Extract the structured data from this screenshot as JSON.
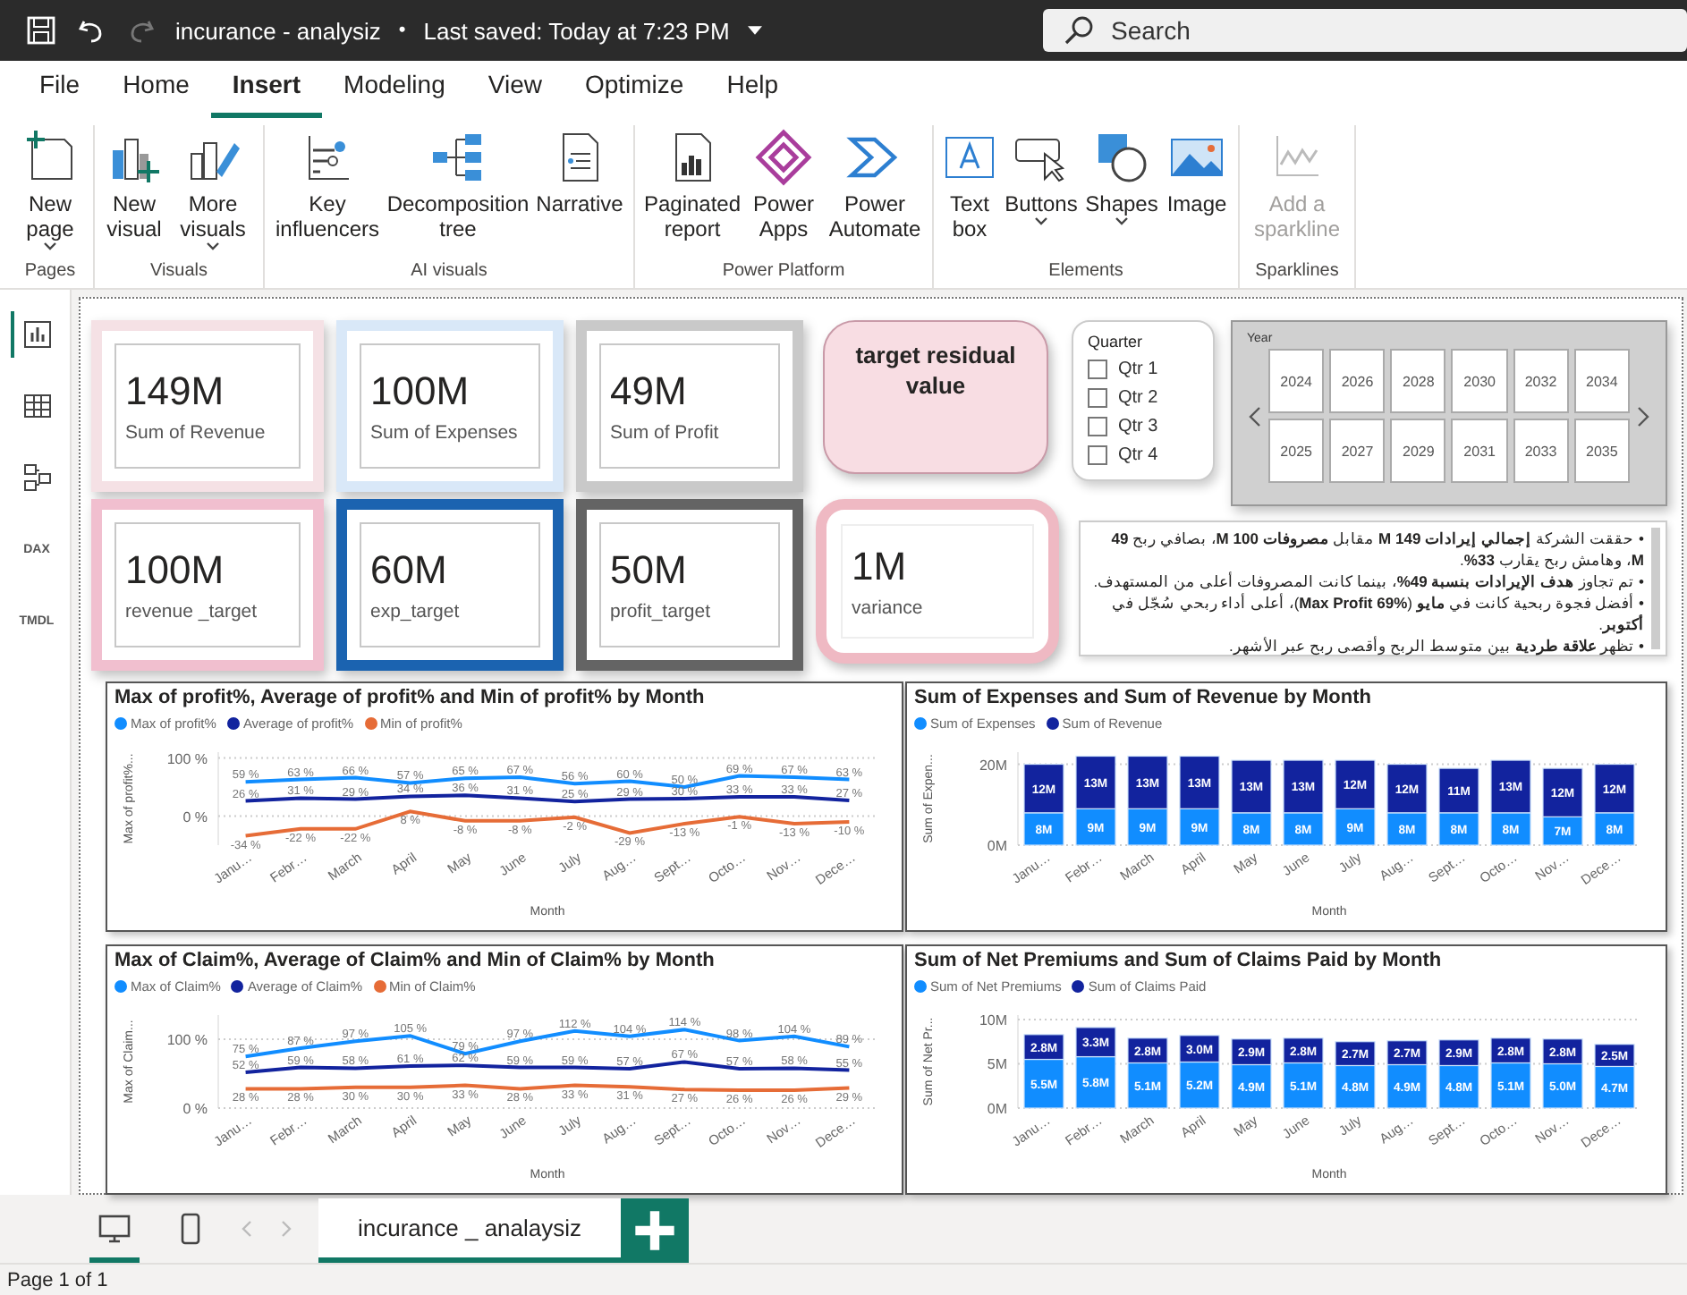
{
  "title_bar": {
    "file_name": "incurance - analysiz",
    "separator": "•",
    "save_status": "Last saved: Today at 7:23 PM",
    "redo_disabled": true,
    "search": {
      "placeholder": "Search"
    }
  },
  "menu_tabs": [
    {
      "label": "File",
      "selected": false
    },
    {
      "label": "Home",
      "selected": false
    },
    {
      "label": "Insert",
      "selected": true
    },
    {
      "label": "Modeling",
      "selected": false
    },
    {
      "label": "View",
      "selected": false
    },
    {
      "label": "Optimize",
      "selected": false
    },
    {
      "label": "Help",
      "selected": false
    }
  ],
  "ribbon_groups": [
    {
      "name": "Pages",
      "buttons": [
        {
          "kind": "new-page",
          "label": "New page",
          "dropdown": true,
          "disabled": false
        }
      ]
    },
    {
      "name": "Visuals",
      "buttons": [
        {
          "kind": "new-visual",
          "label": "New visual",
          "dropdown": false,
          "disabled": false
        },
        {
          "kind": "more-visuals",
          "label": "More visuals",
          "dropdown": true,
          "disabled": false
        }
      ]
    },
    {
      "name": "AI visuals",
      "buttons": [
        {
          "kind": "key-influencers",
          "label": "Key influencers",
          "dropdown": false,
          "disabled": false
        },
        {
          "kind": "decomposition",
          "label": "Decomposition tree",
          "dropdown": false,
          "disabled": false
        },
        {
          "kind": "narrative",
          "label": "Narrative",
          "dropdown": false,
          "disabled": false
        }
      ]
    },
    {
      "name": "Power Platform",
      "buttons": [
        {
          "kind": "paginated",
          "label": "Paginated report",
          "dropdown": false,
          "disabled": false
        },
        {
          "kind": "apps",
          "label": "Power Apps",
          "dropdown": false,
          "disabled": false
        },
        {
          "kind": "automate",
          "label": "Power Automate",
          "dropdown": false,
          "disabled": false
        }
      ]
    },
    {
      "name": "Elements",
      "buttons": [
        {
          "kind": "text-box",
          "label": "Text box",
          "dropdown": false,
          "disabled": false
        },
        {
          "kind": "buttons",
          "label": "Buttons",
          "dropdown": true,
          "disabled": false
        },
        {
          "kind": "shapes",
          "label": "Shapes",
          "dropdown": true,
          "disabled": false
        },
        {
          "kind": "image",
          "label": "Image",
          "dropdown": false,
          "disabled": false
        }
      ]
    },
    {
      "name": "Sparklines",
      "buttons": [
        {
          "kind": "sparkline",
          "label": "Add a sparkline",
          "dropdown": false,
          "disabled": true
        }
      ]
    }
  ],
  "side_rail": [
    {
      "kind": "report",
      "selected": true
    },
    {
      "kind": "table",
      "selected": false
    },
    {
      "kind": "model",
      "selected": false
    },
    {
      "kind": "dax",
      "label": "DAX",
      "selected": false
    },
    {
      "kind": "tmdl",
      "label": "TMDL",
      "selected": false
    }
  ],
  "kpi_cards": [
    {
      "value": "149M",
      "label": "Sum of Revenue",
      "color": "#f5e1e5"
    },
    {
      "value": "100M",
      "label": "Sum of Expenses",
      "color": "#d9e8f8"
    },
    {
      "value": "49M",
      "label": "Sum of Profit",
      "color": "#c9c9c9"
    },
    {
      "value": "100M",
      "label": "revenue _target",
      "color": "#f1bfcf"
    },
    {
      "value": "60M",
      "label": "exp_target",
      "color": "#1b63b0"
    },
    {
      "value": "50M",
      "label": "profit_target",
      "color": "#646464"
    }
  ],
  "target_card": {
    "title": "target residual value"
  },
  "variance_card": {
    "value": "1M",
    "label": "variance"
  },
  "quarter_slicer": {
    "title": "Quarter",
    "options": [
      {
        "label": "Qtr 1",
        "checked": false
      },
      {
        "label": "Qtr 2",
        "checked": false
      },
      {
        "label": "Qtr 3",
        "checked": false
      },
      {
        "label": "Qtr 4",
        "checked": false
      }
    ]
  },
  "year_slicer": {
    "title": "Year",
    "tiles": [
      {
        "label": "2024",
        "selected": false
      },
      {
        "label": "2026",
        "selected": false
      },
      {
        "label": "2028",
        "selected": false
      },
      {
        "label": "2030",
        "selected": false
      },
      {
        "label": "2032",
        "selected": false
      },
      {
        "label": "2034",
        "selected": false
      },
      {
        "label": "2025",
        "selected": false
      },
      {
        "label": "2027",
        "selected": false
      },
      {
        "label": "2029",
        "selected": false
      },
      {
        "label": "2031",
        "selected": false
      },
      {
        "label": "2033",
        "selected": false
      },
      {
        "label": "2035",
        "selected": false
      }
    ]
  },
  "insights": {
    "lines": [
      "• حققت الشركة **إجمالي إيرادات 149 M** مقابل **مصروفات 100 M**، بصافي ربح **49 M**، وهامش ربح يقارب **33%**.",
      "• تم تجاوز **هدف الإيرادات بنسبة 49%**، بينما كانت المصروفات أعلى من المستهدف.",
      "• أفضل فجوة ربحية كانت في **مايو** (**Max Profit 69%**)، أعلى أداء ربحي سُجّل في **أكتوبر**.",
      "• تظهر **علاقة طردية** بين متوسط الربح وأقصى ربح عبر الأشهر."
    ]
  },
  "charts": [
    {
      "chart_data": {
        "type": "line",
        "title": "Max of profit%, Average of profit% and Min of profit% by Month",
        "xlabel": "Month",
        "ylabel": "Max of profit%...",
        "legend": "top",
        "ylim": [
          -50,
          110
        ],
        "categories": [
          "Janu…",
          "Febr…",
          "March",
          "April",
          "May",
          "June",
          "July",
          "Aug…",
          "Sept…",
          "Octo…",
          "Nov…",
          "Dece…"
        ],
        "yticks": [
          {
            "value": 0,
            "label": "0 %"
          },
          {
            "value": 100,
            "label": "100 %"
          }
        ],
        "series": [
          {
            "name": "Max of profit%",
            "color": "#118dff",
            "values": [
              59,
              63,
              66,
              57,
              65,
              67,
              56,
              60,
              50,
              69,
              67,
              63
            ]
          },
          {
            "name": "Average of profit%",
            "color": "#12239e",
            "values": [
              26,
              31,
              29,
              34,
              36,
              31,
              25,
              29,
              30,
              33,
              33,
              27
            ]
          },
          {
            "name": "Min of profit%",
            "color": "#e66c37",
            "values": [
              -34,
              -22,
              -22,
              8,
              -8,
              -8,
              -2,
              -29,
              -13,
              -1,
              -13,
              -10
            ]
          }
        ],
        "value_labels": [
          [
            "59 %",
            "63 %",
            "66 %",
            "57 %",
            "65 %",
            "67 %",
            "56 %",
            "60 %",
            "50 %",
            "69 %",
            "67 %",
            "63 %"
          ],
          [
            "26 %",
            "31 %",
            "29 %",
            "34 %",
            "36 %",
            "31 %",
            "25 %",
            "29 %",
            "30 %",
            "33 %",
            "33 %",
            "27 %"
          ],
          [
            "-34 %",
            "-22 %",
            "-22 %",
            "8 %",
            "-8 %",
            "-8 %",
            "-2 %",
            "-29 %",
            "-13 %",
            "-1 %",
            "-13 %",
            "-10 %"
          ]
        ]
      }
    },
    {
      "chart_data": {
        "type": "bar",
        "stacked": true,
        "orientation": "vertical",
        "title": "Sum of Expenses and Sum of Revenue by Month",
        "xlabel": "Month",
        "ylabel": "Sum of Expen...",
        "legend": "top",
        "ylim": [
          0,
          23
        ],
        "categories": [
          "Janu…",
          "Febr…",
          "March",
          "April",
          "May",
          "June",
          "July",
          "Aug…",
          "Sept…",
          "Octo…",
          "Nov…",
          "Dece…"
        ],
        "yticks": [
          {
            "value": 0,
            "label": "0M"
          },
          {
            "value": 20,
            "label": "20M"
          }
        ],
        "series": [
          {
            "name": "Sum of Expenses",
            "color": "#118dff",
            "values": [
              8,
              9,
              9,
              9,
              8,
              8,
              9,
              8,
              8,
              8,
              7,
              8
            ]
          },
          {
            "name": "Sum of Revenue",
            "color": "#12239e",
            "values": [
              12,
              13,
              13,
              13,
              13,
              13,
              12,
              12,
              11,
              13,
              12,
              12
            ]
          }
        ],
        "value_labels": [
          [
            "8M",
            "9M",
            "9M",
            "9M",
            "8M",
            "8M",
            "9M",
            "8M",
            "8M",
            "8M",
            "7M",
            "8M"
          ],
          [
            "12M",
            "13M",
            "13M",
            "13M",
            "13M",
            "13M",
            "12M",
            "12M",
            "11M",
            "13M",
            "12M",
            "12M"
          ]
        ]
      }
    },
    {
      "chart_data": {
        "type": "line",
        "title": "Max of Claim%, Average of Claim% and Min of Claim% by Month",
        "xlabel": "Month",
        "ylabel": "Max of Claim...",
        "legend": "top",
        "ylim": [
          0,
          135
        ],
        "categories": [
          "Janu…",
          "Febr…",
          "March",
          "April",
          "May",
          "June",
          "July",
          "Aug…",
          "Sept…",
          "Octo…",
          "Nov…",
          "Dece…"
        ],
        "yticks": [
          {
            "value": 0,
            "label": "0 %"
          },
          {
            "value": 100,
            "label": "100 %"
          }
        ],
        "series": [
          {
            "name": "Max of Claim%",
            "color": "#118dff",
            "values": [
              75,
              87,
              97,
              105,
              79,
              97,
              112,
              104,
              114,
              98,
              104,
              89
            ]
          },
          {
            "name": "Average of Claim%",
            "color": "#12239e",
            "values": [
              52,
              59,
              58,
              61,
              62,
              59,
              59,
              57,
              67,
              57,
              58,
              55
            ]
          },
          {
            "name": "Min of Claim%",
            "color": "#e66c37",
            "values": [
              28,
              28,
              30,
              30,
              33,
              28,
              33,
              31,
              27,
              26,
              26,
              29
            ]
          }
        ],
        "value_labels": [
          [
            "75 %",
            "87 %",
            "97 %",
            "105 %",
            "79 %",
            "97 %",
            "112 %",
            "104 %",
            "114 %",
            "98 %",
            "104 %",
            "89 %"
          ],
          [
            "52 %",
            "59 %",
            "58 %",
            "61 %",
            "62 %",
            "59 %",
            "59 %",
            "57 %",
            "67 %",
            "57 %",
            "58 %",
            "55 %"
          ],
          [
            "28 %",
            "28 %",
            "30 %",
            "30 %",
            "33 %",
            "28 %",
            "33 %",
            "31 %",
            "27 %",
            "26 %",
            "26 %",
            "29 %"
          ]
        ]
      }
    },
    {
      "chart_data": {
        "type": "bar",
        "stacked": true,
        "orientation": "vertical",
        "title": "Sum of Net Premiums and Sum of Claims Paid by Month",
        "xlabel": "Month",
        "ylabel": "Sum of Net Pr...",
        "legend": "top",
        "ylim": [
          0,
          10.5
        ],
        "categories": [
          "Janu…",
          "Febr…",
          "March",
          "April",
          "May",
          "June",
          "July",
          "Aug…",
          "Sept…",
          "Octo…",
          "Nov…",
          "Dece…"
        ],
        "yticks": [
          {
            "value": 0,
            "label": "0M"
          },
          {
            "value": 5,
            "label": "5M"
          },
          {
            "value": 10,
            "label": "10M"
          }
        ],
        "series": [
          {
            "name": "Sum of Net Premiums",
            "color": "#118dff",
            "values": [
              5.5,
              5.8,
              5.1,
              5.2,
              4.9,
              5.1,
              4.8,
              4.9,
              4.8,
              5.1,
              5.0,
              4.7
            ]
          },
          {
            "name": "Sum of Claims Paid",
            "color": "#12239e",
            "values": [
              2.8,
              3.3,
              2.8,
              3.0,
              2.9,
              2.8,
              2.7,
              2.7,
              2.9,
              2.8,
              2.8,
              2.5
            ]
          }
        ],
        "value_labels": [
          [
            "5.5M",
            "5.8M",
            "5.1M",
            "5.2M",
            "4.9M",
            "5.1M",
            "4.8M",
            "4.9M",
            "4.8M",
            "5.1M",
            "5.0M",
            "4.7M"
          ],
          [
            "2.8M",
            "3.3M",
            "2.8M",
            "3.0M",
            "2.9M",
            "2.8M",
            "2.7M",
            "2.7M",
            "2.9M",
            "2.8M",
            "2.8M",
            "2.5M"
          ]
        ]
      }
    }
  ],
  "page_tabs": {
    "view_options": [
      {
        "kind": "desktop",
        "selected": true
      },
      {
        "kind": "mobile",
        "selected": false
      }
    ],
    "pages": [
      {
        "label": "incurance _ analaysiz",
        "selected": true
      }
    ]
  },
  "status_bar": {
    "text": "Page 1 of 1"
  }
}
